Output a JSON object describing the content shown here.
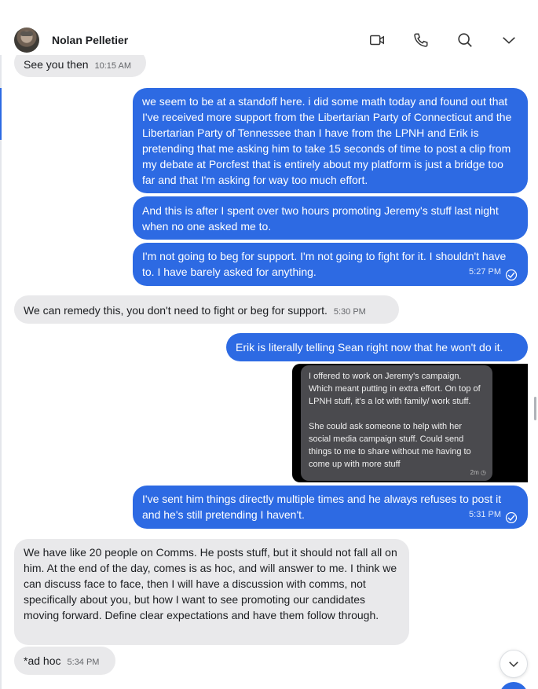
{
  "header": {
    "contact_name": "Nolan Pelletier",
    "icons": [
      "video-call-icon",
      "phone-call-icon",
      "search-icon",
      "chevron-down-icon"
    ]
  },
  "colors": {
    "outgoing_bubble": "#2d6ae3",
    "incoming_bubble": "#e9e9eb",
    "read_receipt": "#ffffff"
  },
  "messages": [
    {
      "dir": "in",
      "text": "See you then",
      "time": "10:15 AM"
    },
    {
      "dir": "out",
      "text": "we seem to be at a standoff here. i did some math today and found out that I've received more support from the Libertarian Party of Connecticut and the Libertarian Party of Tennessee than I have from the LPNH and Erik is pretending that me asking him to take 15 seconds of time to post a clip from my debate at Porcfest that is entirely about my platform is just a bridge too far and that I'm asking for way too much effort."
    },
    {
      "dir": "out",
      "text": "And this is after I spent over two hours promoting Jeremy's stuff last night when no one asked me to."
    },
    {
      "dir": "out",
      "text": "I'm not going to beg for support. I'm not going to fight for it. I shouldn't have to. I have barely asked for anything.",
      "time": "5:27 PM"
    },
    {
      "dir": "in",
      "text": "We can remedy this, you don't need to fight or beg for support.",
      "time": "5:30 PM"
    },
    {
      "dir": "out",
      "text": "Erik is literally telling Sean right now that he won't do it."
    },
    {
      "dir": "out",
      "text": "I've sent him things directly multiple times and he always refuses to post it and he's still pretending I haven't.",
      "time": "5:31 PM"
    },
    {
      "dir": "in",
      "text": "We have like 20 people on Comms.  He posts stuff, but it should not fall all on him.  At the end of the day, comes is as hoc, and will answer to me.  I think we can discuss face to face, then I will have a discussion with comms, not specifically about you, but how I want to see promoting our candidates moving forward.  Define clear expectations and have them follow through."
    },
    {
      "dir": "in",
      "text": "*ad hoc",
      "time": "5:34 PM"
    }
  ],
  "screenshot_attachment": {
    "paragraph_1": "I offered to work on Jeremy's campaign. Which meant putting in extra effort. On top of LPNH stuff, it's a lot with family/ work stuff.",
    "paragraph_2": "She could ask someone to help with her social media campaign stuff. Could send things to me to share without me having to come up with more stuff",
    "meta": "2m"
  }
}
